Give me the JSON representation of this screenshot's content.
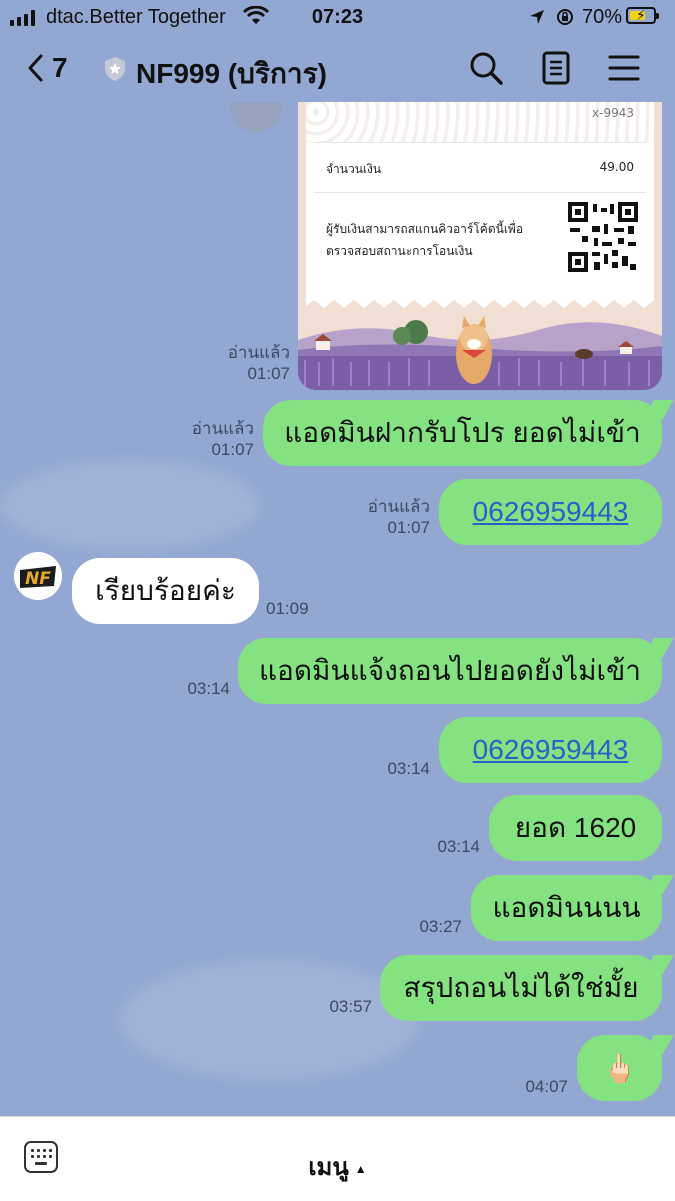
{
  "status_bar": {
    "carrier": "dtac.Better Together",
    "time": "07:23",
    "battery": "70%"
  },
  "header": {
    "back_count": "7",
    "title": "NF999 (บริการ)"
  },
  "receipt": {
    "account_suffix": "x-9943",
    "amount_label": "จำนวนเงิน",
    "amount_value": "49.00",
    "qr_note_line1": "ผู้รับเงินสามารถสแกนคิวอาร์โค้ดนี้เพื่อ",
    "qr_note_line2": "ตรวจสอบสถานะการโอนเงิน",
    "meta_read": "อ่านแล้ว",
    "meta_time": "01:07"
  },
  "messages": [
    {
      "dir": "out",
      "text": "แอดมินฝากรับโปร ยอดไม่เข้า",
      "read": "อ่านแล้ว",
      "time": "01:07"
    },
    {
      "dir": "out",
      "text": "0626959443",
      "link": true,
      "read": "อ่านแล้ว",
      "time": "01:07"
    },
    {
      "dir": "in",
      "text": "เรียบร้อยค่ะ",
      "time": "01:09"
    },
    {
      "dir": "out",
      "text": "แอดมินแจ้งถอนไปยอดยังไม่เข้า",
      "time": "03:14"
    },
    {
      "dir": "out",
      "text": "0626959443",
      "link": true,
      "time": "03:14"
    },
    {
      "dir": "out",
      "text": "ยอด 1620",
      "time": "03:14"
    },
    {
      "dir": "out",
      "text": "แอดมินนนน",
      "time": "03:27"
    },
    {
      "dir": "out",
      "text": "สรุปถอนไม่ได้ใช่มั้ย",
      "time": "03:57"
    },
    {
      "dir": "out",
      "text": "🖕🏻",
      "time": "04:07"
    }
  ],
  "bottom_bar": {
    "menu_label": "เมนู"
  },
  "colors": {
    "chat_bg": "#92a8d2",
    "out_bubble": "#85e281",
    "in_bubble": "#ffffff",
    "link": "#2b5fc9"
  }
}
